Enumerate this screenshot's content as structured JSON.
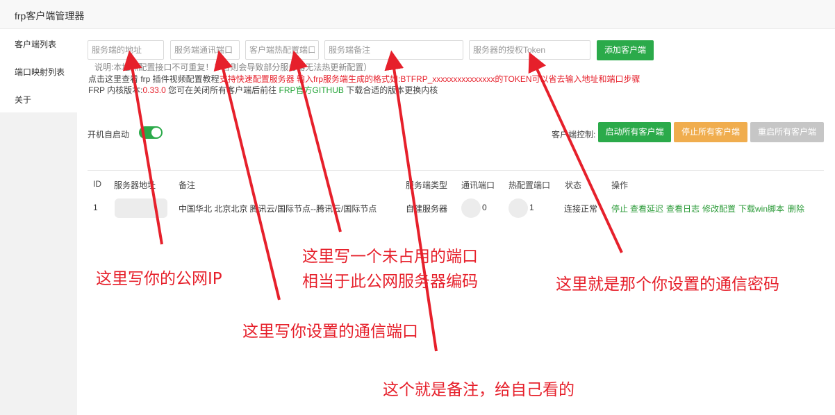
{
  "window": {
    "title": "frp客户端管理器"
  },
  "sidebar": {
    "items": [
      "客户端列表",
      "端口映射列表",
      "关于"
    ]
  },
  "form": {
    "server_addr_placeholder": "服务端的地址",
    "server_port_placeholder": "服务端通讯端口",
    "hot_config_port_placeholder": "客户端热配置端口",
    "remark_placeholder": "服务端备注",
    "token_placeholder": "服务器的授权Token",
    "add_button": "添加客户端"
  },
  "notes": {
    "hint": "说明:本地热配置接口不可重复！！否则会导致部分服务器无法热更新配置）",
    "line1_dark": "点击这里查看 frp 插件视频配置教程",
    "line1_red": "支持快速配置服务器 输入frp服务端生成的格式如:BTFRP_xxxxxxxxxxxxxxx的TOKEN可以省去输入地址和端口步骤",
    "line2_prefix": "FRP 内核版本:",
    "line2_version": "0.33.0",
    "line2_mid": "您可在关闭所有客户端后前往",
    "line2_link": "FRP官方GITHUB",
    "line2_suffix": "下载合适的版本更换内核"
  },
  "autostart": {
    "label": "开机自启动",
    "enabled": true
  },
  "controls": {
    "label": "客户端控制:",
    "start_all": "启动所有客户端",
    "stop_all": "停止所有客户端",
    "restart_all": "重启所有客户端"
  },
  "table": {
    "headers": [
      "ID",
      "服务器地址",
      "备注",
      "服务端类型",
      "通讯端口",
      "热配置端口",
      "状态",
      "操作"
    ],
    "rows": [
      {
        "id": "1",
        "remark": "中国华北 北京北京 腾讯云/国际节点--腾讯云/国际节点",
        "server_type": "自建服务器",
        "comm_port_tail": "0",
        "hot_port_tail": "1",
        "status": "连接正常",
        "actions": [
          "停止",
          "查看延迟",
          "查看日志",
          "修改配置",
          "下载win脚本",
          "删除"
        ]
      }
    ]
  },
  "annotations": {
    "public_ip": "这里写你的公网IP",
    "comm_port": "这里写你设置的通信端口",
    "unused_port_line1": "这里写一个未占用的端口",
    "unused_port_line2": "相当于此公网服务器编码",
    "remark": "这个就是备注，给自己看的",
    "token": "这里就是那个你设置的通信密码"
  },
  "colors": {
    "accent_green": "#2baa4a",
    "warning_orange": "#f0ad4e",
    "annotation_red": "#e6202b"
  }
}
